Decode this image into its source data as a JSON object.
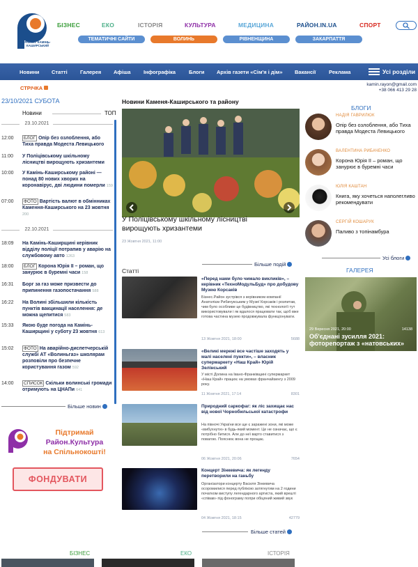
{
  "logo": {
    "text": "РАЙОН. КАМІНЬ-КАШИРСЬКИЙ"
  },
  "topnav": [
    {
      "label": "БІЗНЕС",
      "color": "#3a9d3a"
    },
    {
      "label": "ЕКО",
      "color": "#4caf88"
    },
    {
      "label": "ІСТОРІЯ",
      "color": "#888888"
    },
    {
      "label": "КУЛЬТУРА",
      "color": "#8e2fa7"
    },
    {
      "label": "МЕДИЦИНА",
      "color": "#5aa7d8"
    },
    {
      "label": "РАЙОН.IN.UA",
      "color": "#1b4e8c"
    },
    {
      "label": "СПОРТ",
      "color": "#d7271d"
    }
  ],
  "pills": [
    {
      "label": "ТЕМАТИЧНІ САЙТИ",
      "color": "#5b8fd0"
    },
    {
      "label": "ВОЛИНЬ",
      "color": "#e8792b"
    },
    {
      "label": "РІВНЕНЩИНА",
      "color": "#5b8fd0"
    },
    {
      "label": "ЗАКАРПАТТЯ",
      "color": "#5b8fd0"
    }
  ],
  "menu": [
    "Новини",
    "Статті",
    "Галерея",
    "Афіша",
    "Інфографіка",
    "Блоги",
    "Архів газети «Сім'я і дім»",
    "Вакансії",
    "Реклама"
  ],
  "menu_all": "Усі розділи",
  "stream_label": "СТРІЧКА",
  "contact": {
    "email": "kamin.rayon@gmail.com",
    "phone": "+38 066 413 29 28"
  },
  "today": "23/10/2021  СУБОТА",
  "feed_tabs": {
    "news": "Новини",
    "top": "ТОП"
  },
  "feed": [
    {
      "kind": "date",
      "text": "23.10.2021"
    },
    {
      "time": "12:00",
      "tag": "БЛОГ",
      "text": "Опір без озлоблення, або Тиха правда Модеста Левицького",
      "views": ""
    },
    {
      "time": "11:00",
      "tag": "",
      "text": "У Поліцівському шкільному лісництві вирощують хризантеми",
      "views": ""
    },
    {
      "time": "10:00",
      "tag": "",
      "text": "У Камінь-Каширському районі — понад 80 нових хворих на коронавірус, дві людини померли",
      "views": "159"
    },
    {
      "time": "07:00",
      "tag": "ФОТО",
      "text": "Вартість валют в обмінниках Камення-Каширського на 23 жовтня",
      "views": "200"
    },
    {
      "kind": "date",
      "text": "22.10.2021"
    },
    {
      "time": "18:09",
      "tag": "",
      "text": "На Камінь-Каширщині керівник відділу поліції потрапив у аварію на службовому авто",
      "views": "1263"
    },
    {
      "time": "18:00",
      "tag": "БЛОГ",
      "text": "Корона Юрія ІІ – роман, що занурює в буремні часи",
      "views": "158"
    },
    {
      "time": "16:31",
      "tag": "",
      "text": "Борг за газ може призвести до припинення газопостачання",
      "views": "588"
    },
    {
      "time": "16:22",
      "tag": "",
      "text": "На Волині збільшили кількість пунктів вакцинації населення: де можна щепитися",
      "views": "583"
    },
    {
      "time": "15:33",
      "tag": "",
      "text": "Якою буде погода на Камінь-Каширщині у суботу 23 жовтня",
      "views": "613"
    },
    {
      "time": "15:02",
      "tag": "ФОТО",
      "text": "На аварійно-диспетчерській службі АТ «Волиньгаз» школярам розповіли про безпечне користування газом",
      "views": "592"
    },
    {
      "time": "14:00",
      "tag": "СПИСОК",
      "text": "Скільки волинські громади отримують на ЦНАПи",
      "views": "641"
    }
  ],
  "feed_more": "Більше новин",
  "support": {
    "line1": "Підтримай",
    "line2": "Район.Культура",
    "line3": "на Спільнокошті!",
    "button": "ФОНДУВАТИ"
  },
  "center_title": "Новини Каменя-Каширського та району",
  "hero": {
    "title": "У Поліцівському шкільному лісництві вирощують хризантеми",
    "date": "23 Жовтня 2021, 11:00"
  },
  "hero_more": "Більше подій",
  "articles_label": "Статті",
  "articles": [
    {
      "title": "«Перед нами було чимало викликів», – керівник «ТехноМодульБуд» про добудову Музею Корсаків",
      "text": "Бізнес.Район зустрівся з керівником компанії Анатолієм Рибачукським у Музеї Корсаків і розпитав, чим було особливе це будівництво, які технології тут використовували і як вдалося працювати так, щоб вже готова частина музею продовжувала функціонувати.",
      "date": "13 Жовтня 2021, 18:00",
      "views": "5688"
    },
    {
      "title": "«Великі мережі все частіше заходять у малі населені пункти», – власник супермаркету «Наш Край» Юрій Зелінський",
      "text": "У місті Долина на Івано-Франківщині супермаркет «Наш Край» працює на умовах франчайзингу з 2009 року.",
      "date": "11 Жовтня 2021, 17:14",
      "views": "8301"
    },
    {
      "title": "Природний саркофаг: як ліс захищає нас від нової Чорнобильської катастрофи",
      "text": "На півночі України все ще є заражені зони, які може «вибухнути» в будь-який момент. Це не означає, що є потрібно битися. Але до неї варто ставитися з повагою. Пояснює вона не прощає.",
      "date": "06 Жовтня 2021, 20:06",
      "views": "7654"
    },
    {
      "title": "Концерт Зінкевича: як легенду перетворили на ганьбу",
      "text": "Організатори концерту Василя Зінкевича осоромилися перед публікою затягнутим на 2 години початком виступу легендарного артиста, який врешті «співав» під фонограму попри обіцяний живий звук",
      "date": "04 Жовтня 2021, 18:15",
      "views": "42779"
    }
  ],
  "articles_more": "Більше статей",
  "blogs_title": "БЛОГИ",
  "blogs": [
    {
      "author": "НАДІЯ ГАВРИЛЮК",
      "title": "Опір без озлоблення, або Тиха правда Модеста Левицького"
    },
    {
      "author": "ВАЛЕНТИНА РИБАЧЕНКО",
      "title": "Корона Юрія ІІ – роман, що занурює в буремні часи"
    },
    {
      "author": "ЮЛІЯ КАШТАН",
      "title": "Книга, яку хочеться наполегливо рекомендувати"
    },
    {
      "author": "СЕРГІЙ КОШАРУК",
      "title": "Паливо з топінамбура"
    }
  ],
  "blogs_more": "Усі блоги",
  "gallery_title": "ГАЛЕРЕЯ",
  "gallery": {
    "date": "29 Вересня 2021, 20:00",
    "views": "14138",
    "title": "Об'єднані зусилля 2021: фоторепортаж з «натовських»"
  },
  "bottom_cats": [
    {
      "label": "БІЗНЕС",
      "color": "#3a9d3a"
    },
    {
      "label": "ЕКО",
      "color": "#4caf88"
    },
    {
      "label": "ІСТОРІЯ",
      "color": "#888888"
    }
  ]
}
